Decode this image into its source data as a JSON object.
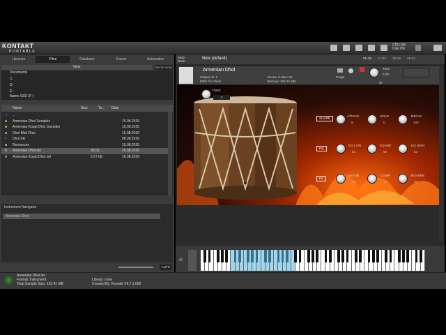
{
  "app": {
    "name": "KONTAKT",
    "edition": "PORTABLE"
  },
  "cpu": {
    "line1": "CPU 0%",
    "line2": "Disk 0%"
  },
  "browser": {
    "tabs": [
      "Libraries",
      "Files",
      "Database",
      "Expert",
      "Automation"
    ],
    "active_tab": "Files",
    "view_label": "View",
    "entry_label": "ENTRY ROW"
  },
  "tree": [
    "Documents",
    "C:",
    "D:",
    "E:",
    "Name SSD (F:)"
  ],
  "files": {
    "columns": [
      "Name",
      "Size",
      "Te...",
      "Date"
    ],
    "rows": [
      {
        "name": "..",
        "size": "",
        "date": ""
      },
      {
        "name": "Armenian Dhol Samples",
        "size": "",
        "date": "15.08.2026"
      },
      {
        "name": "Armenian Kopal Dhol Samples",
        "size": "",
        "date": "15.08.2026"
      },
      {
        "name": "Dhol Midi Files",
        "size": "",
        "date": "15.08.2026"
      },
      {
        "name": "Dhol.nkr",
        "size": "",
        "date": "08.08.2026"
      },
      {
        "name": "Resources",
        "size": "",
        "date": "15.08.2026"
      },
      {
        "name": "Armenian Dhol.nki",
        "size": "38.53 ...",
        "date": "16.08.2026"
      },
      {
        "name": "Armenian Kopal Dhol.nki",
        "size": "5.57 kB",
        "date": "16.08.2026"
      }
    ]
  },
  "navigator": {
    "title": "Instrument Navigator",
    "item": "Armenian Dhol"
  },
  "auto_label": "AUTO",
  "status": {
    "file": "Armenian Dhol.nki",
    "format": "Format: Instrument",
    "size": "Total Sample Size: 152.41 MB",
    "library": "Library: none",
    "created": "Created By: Kontakt V6.7.1.000"
  },
  "rack": {
    "multi_label": "Multi Rack",
    "preset": "New (default)",
    "ranges": [
      "01-16",
      "17-32",
      "33-48",
      "49-64"
    ]
  },
  "instrument": {
    "name": "Armenian Dhol",
    "output": "st. 1",
    "midi": "Omni",
    "voices_label": "Voices:",
    "voices": "0",
    "max_label": "Max:",
    "max": "64",
    "memory": "152.41 MB",
    "purge": "Purge",
    "tune_label": "Tune",
    "tune_value": "0.00",
    "pan_value": "57"
  },
  "ui": {
    "tune": {
      "label": "TUNE",
      "value": "0"
    },
    "sections": [
      {
        "tag": "SHAPE",
        "knobs": [
          {
            "label": "ATTACK",
            "value": "9"
          },
          {
            "label": "HOLD",
            "value": "0"
          },
          {
            "label": "DECAY",
            "value": "100"
          }
        ]
      },
      {
        "tag": "EQ",
        "knobs": [
          {
            "label": "EQ LOW",
            "value": "53"
          },
          {
            "label": "EQ MID",
            "value": "56"
          },
          {
            "label": "EQ HIGH",
            "value": "53"
          }
        ]
      },
      {
        "tag": "FX",
        "knobs": [
          {
            "label": "SATUR",
            "value": "28"
          },
          {
            "label": "COMP",
            "value": "14"
          },
          {
            "label": "REVERB",
            "value": "20"
          }
        ]
      }
    ]
  },
  "keyboard": {
    "octave_label": "+0"
  }
}
